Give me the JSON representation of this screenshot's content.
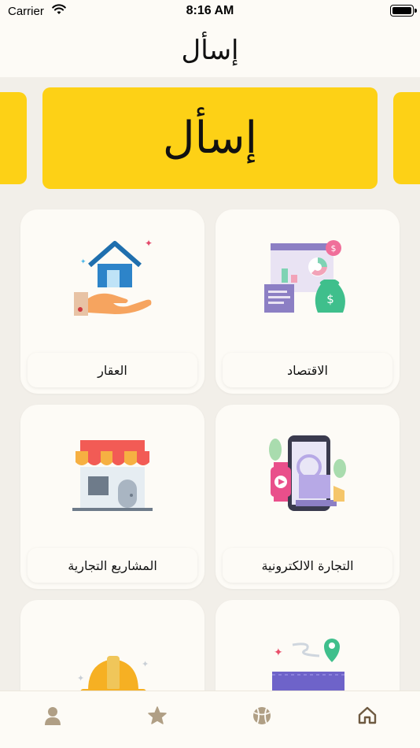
{
  "status_bar": {
    "carrier": "Carrier",
    "time": "8:16 AM"
  },
  "header": {
    "logo_text": "إسأل"
  },
  "banner": {
    "logo_text": "إسأل",
    "color": "#fdd116"
  },
  "categories": [
    {
      "label": "الاقتصاد",
      "icon": "economy-icon"
    },
    {
      "label": "العقار",
      "icon": "real-estate-icon"
    },
    {
      "label": "التجارة الالكترونية",
      "icon": "ecommerce-icon"
    },
    {
      "label": "المشاريع التجارية",
      "icon": "commercial-projects-icon"
    },
    {
      "label": "",
      "icon": "map-route-icon"
    },
    {
      "label": "",
      "icon": "hard-hat-icon"
    }
  ],
  "tab_bar": {
    "tabs": [
      {
        "icon": "home-icon",
        "active": true
      },
      {
        "icon": "basketball-icon",
        "active": false
      },
      {
        "icon": "star-icon",
        "active": false
      },
      {
        "icon": "user-icon",
        "active": false
      }
    ],
    "active_color": "#6e5a41",
    "inactive_color": "#b09f85"
  }
}
